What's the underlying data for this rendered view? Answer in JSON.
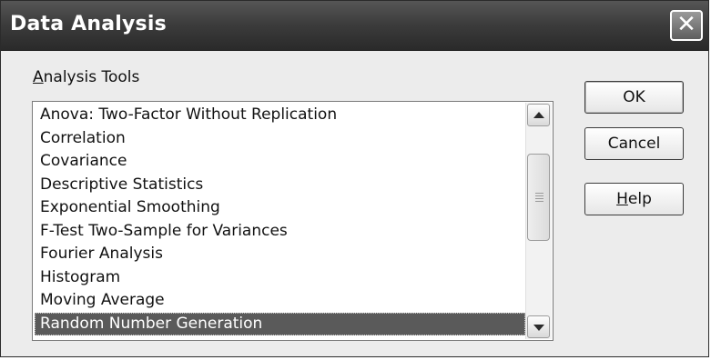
{
  "window": {
    "title": "Data Analysis"
  },
  "group": {
    "label_prefix": "",
    "label_access": "A",
    "label_rest": "nalysis Tools"
  },
  "tools": [
    "Anova: Two-Factor Without Replication",
    "Correlation",
    "Covariance",
    "Descriptive Statistics",
    "Exponential Smoothing",
    "F-Test Two-Sample for Variances",
    "Fourier Analysis",
    "Histogram",
    "Moving Average",
    "Random Number Generation"
  ],
  "selected_tool": "Random Number Generation",
  "buttons": {
    "ok": "OK",
    "cancel": "Cancel",
    "help_access": "H",
    "help_rest": "elp"
  },
  "icons": {
    "close": "close-icon",
    "up": "arrow-up-icon",
    "down": "arrow-down-icon"
  }
}
